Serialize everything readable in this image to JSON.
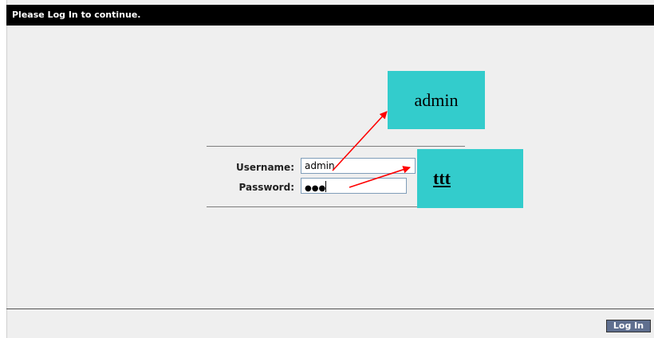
{
  "titlebar": {
    "text": "Please Log In to continue."
  },
  "form": {
    "username_label": "Username:",
    "username_value": "admin",
    "password_label": "Password:",
    "password_value": "●●●"
  },
  "footer": {
    "login_label": "Log In"
  },
  "annotations": {
    "callout_username": "admin",
    "callout_password": "ttt"
  },
  "colors": {
    "callout_bg": "#33cccc",
    "arrow": "#ff0000",
    "titlebar_bg": "#000000",
    "button_bg": "#5f6f8f"
  }
}
